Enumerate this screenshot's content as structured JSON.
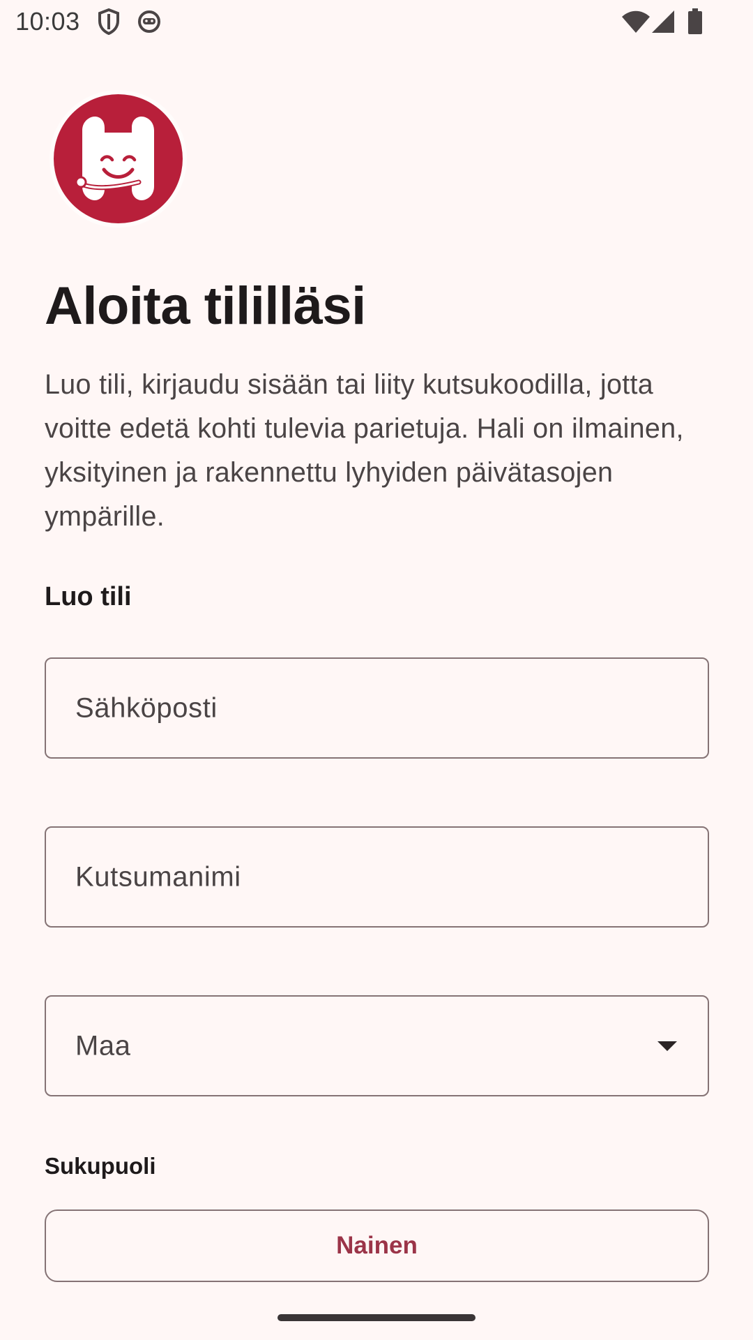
{
  "status_bar": {
    "time": "10:03",
    "left_icons": [
      "shield-icon",
      "android-icon"
    ],
    "right_icons": [
      "wifi-icon",
      "signal-icon",
      "battery-icon"
    ]
  },
  "logo": {
    "name": "hali-logo",
    "color": "#B81F3A"
  },
  "header": {
    "title": "Aloita tililläsi",
    "intro": "Luo tili, kirjaudu sisään tai liity kutsukoodilla, jotta voitte edetä kohti tulevia parietuja. Hali on ilmainen, yksityinen ja rakennettu lyhyiden päivätasojen ympärille."
  },
  "form": {
    "section_title": "Luo tili",
    "email_label": "Sähköposti",
    "nickname_label": "Kutsumanimi",
    "country_label": "Maa",
    "gender_label": "Sukupuoli",
    "gender_option": "Nainen"
  },
  "colors": {
    "background": "#FFF7F6",
    "accent": "#B81F3A",
    "button_text": "#9B3448",
    "outline": "#857375"
  }
}
